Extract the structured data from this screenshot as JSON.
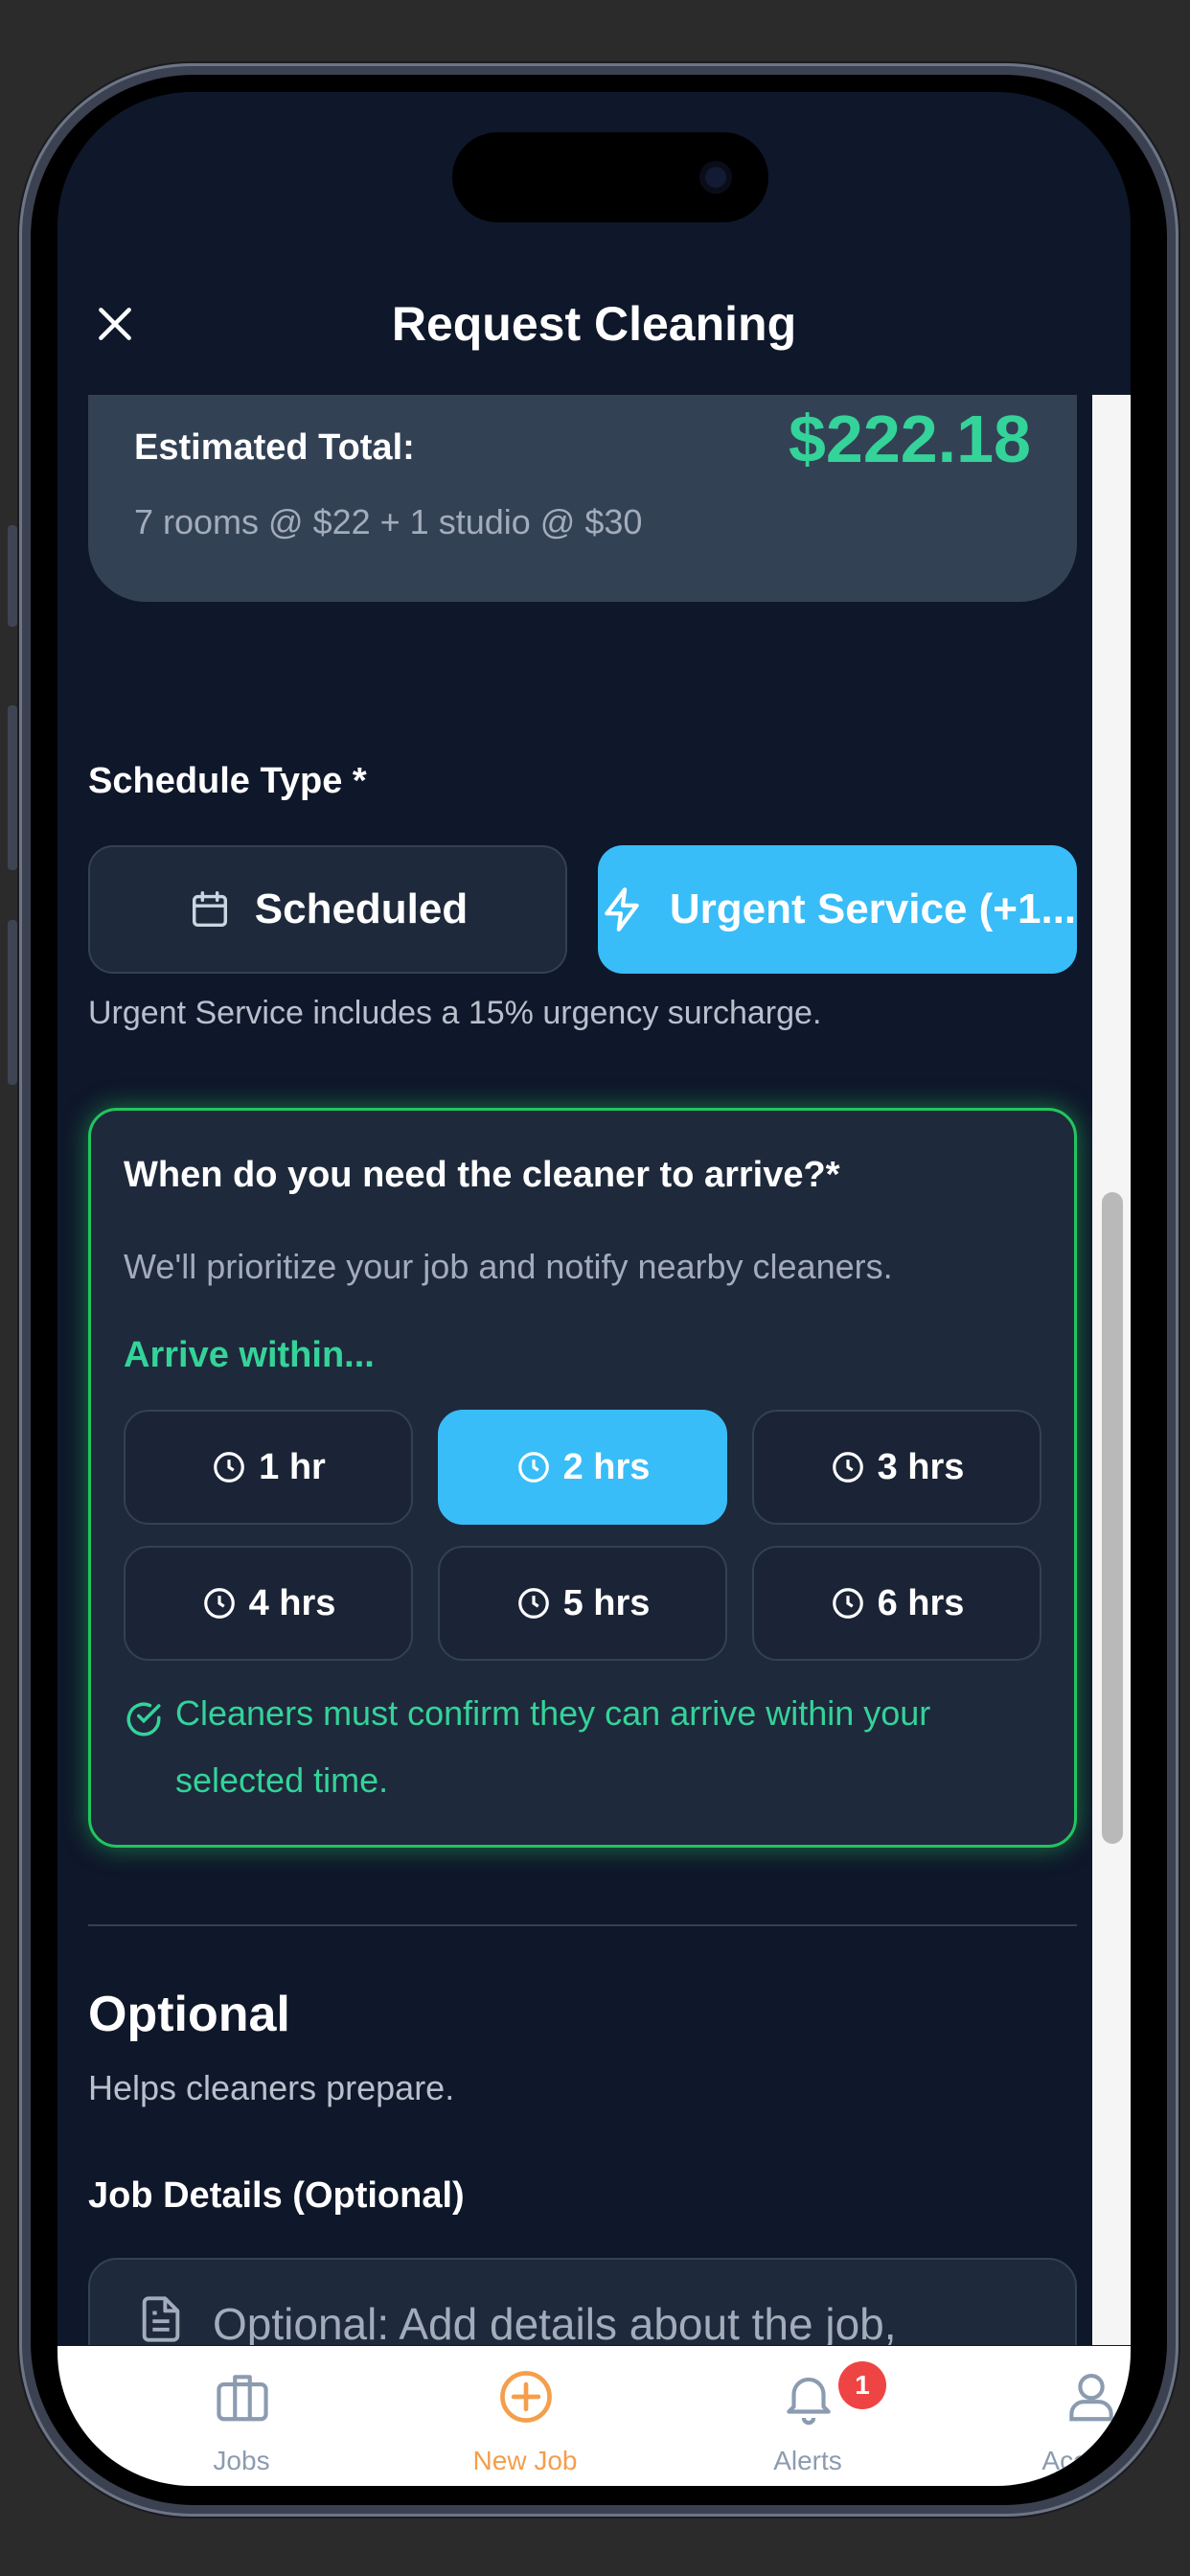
{
  "header": {
    "title": "Request Cleaning",
    "close_icon": "close-icon"
  },
  "estimate": {
    "label": "Estimated Total:",
    "value": "$222.18",
    "breakdown": "7 rooms @ $22 + 1 studio @ $30"
  },
  "schedule": {
    "label": "Schedule Type *",
    "options": [
      {
        "label": "Scheduled",
        "icon": "calendar-icon",
        "selected": false
      },
      {
        "label": "Urgent Service (+1...",
        "icon": "lightning-icon",
        "selected": true
      }
    ],
    "hint": "Urgent Service includes a 15% urgency surcharge."
  },
  "urgent": {
    "title": "When do you need the cleaner to arrive?*",
    "description": "We'll prioritize your job and notify nearby cleaners.",
    "arrive_label": "Arrive within...",
    "slots": [
      {
        "label": "1 hr",
        "selected": false
      },
      {
        "label": "2 hrs",
        "selected": true
      },
      {
        "label": "3 hrs",
        "selected": false
      },
      {
        "label": "4 hrs",
        "selected": false
      },
      {
        "label": "5 hrs",
        "selected": false
      },
      {
        "label": "6 hrs",
        "selected": false
      }
    ],
    "note": "Cleaners must confirm they can arrive within your selected time."
  },
  "optional": {
    "title": "Optional",
    "subtitle": "Helps cleaners prepare.",
    "details_label": "Job Details (Optional)",
    "details_placeholder": "Optional: Add details about the job, special requests, or required equipment."
  },
  "tabs": [
    {
      "label": "Jobs",
      "icon": "briefcase-icon",
      "active": false
    },
    {
      "label": "New Job",
      "icon": "plus-circle-icon",
      "active": true
    },
    {
      "label": "Alerts",
      "icon": "bell-icon",
      "active": false,
      "badge": "1"
    },
    {
      "label": "Account",
      "icon": "user-icon",
      "active": false
    }
  ],
  "colors": {
    "background": "#0f172a",
    "card": "#1e293b",
    "accent_blue": "#38bdf8",
    "accent_green": "#34d399",
    "tab_active": "#f59e4b",
    "tab_inactive": "#8b9bb0",
    "badge": "#ef4444"
  }
}
